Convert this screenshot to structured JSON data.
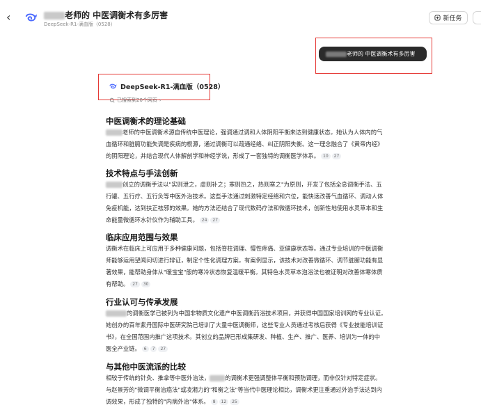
{
  "header": {
    "title_suffix": "老师的 中医调衡术有多厉害",
    "subtitle": "DeepSeek-R1-满血版（0528）",
    "new_task_label": "新任务"
  },
  "user_message": {
    "text_suffix": "老师的 中医调衡术有多厉害"
  },
  "answer": {
    "model_label": "DeepSeek-R1-满血版（0528）",
    "search_label": "已搜索到20个网页",
    "sections": [
      {
        "heading": "中医调衡术的理论基础",
        "lines": [
          "老师的中医调衡术源自传统中医理论，强调通过调和人体阴阳平衡来达到健康状态。她认为人体内的气",
          "血循环和脏腑功能失调是疾病的根源，通过调衡可以疏通经络、纠正阴阳失衡。这一理念融合了《黄帝内经》",
          "的阴阳理论，并结合现代人体解剖学和神经学说，形成了一套独特的调衡医学体系。"
        ],
        "citations": [
          "10",
          "27"
        ]
      },
      {
        "heading": "技术特点与手法创新",
        "lines": [
          "创立的调衡手法以\"实则泄之，虚则补之；寒则热之，热则寒之\"为原则，开发了包括全息调衡手法、五",
          "行罐、五行疗、五行灸等中医外治技术。这些手法通过刺激特定经络和穴位，能快速改善气血循环、调动人体",
          "免疫机能，达到扶正祛邪的效果。她的方法还结合了现代数码疗法和微循环技术，创新性地使用水灵草本和生",
          "命能量微循环水针仪作为辅助工具。"
        ],
        "citations": [
          "24",
          "27"
        ]
      },
      {
        "heading": "临床应用范围与效果",
        "lines": [
          "调衡术在临床上可应用于多种健康问题，包括脊柱调理、慢性疼痛、亚健康状态等。通过专业培训的中医调衡",
          "师能够运用望闻问切进行辩证，制定个性化调理方案。有案例显示，该技术对改善微循环、调节脏腑功能有显",
          "著效果，能帮助身体从\"暖宝宝\"般的寒冷状态恢复温暖平衡。其特色水灵草本泡浴法也被证明对改善体寒体质",
          "有帮助。"
        ],
        "citations": [
          "27",
          "30"
        ]
      },
      {
        "heading": "行业认可与传承发展",
        "lines": [
          "的调衡医学已被列为中国非物质文化遗产中医调衡药浴技术项目，并获得中国国家培训网的专业认证。",
          "她创办的百年紫丹国际中医研究院已培训了大量中医调衡师，这些专业人员通过考核后获得《专业技能培训证",
          "书》，在全国范围内推广这项技术。其创立的品牌已形成集研发、种植、生产、推广、医养、培训为一体的中",
          "医全产业链。"
        ],
        "citations": [
          "6",
          "7",
          "27"
        ]
      },
      {
        "heading": "与其他中医流派的比较",
        "lines": [
          "相较于传统的针灸、推拿等中医外治法，",
          "的调衡术更强调整体平衡和预防调理，而非仅针对特定症状。",
          "与赵景芳的\"微调平衡治癌法\"或凌湘力的\"和衡之法\"等当代中医理论相比，调衡术更注重通过外治手法达到内",
          "调效果，形成了独特的\"内病外治\"体系。"
        ],
        "citations": [
          "8",
          "12",
          "25"
        ]
      }
    ]
  },
  "colors": {
    "highlight_box": "#e53935",
    "bubble_bg": "#2b2b2b",
    "citation_bg": "#eef0f3"
  },
  "icons": [
    "back-arrow-icon",
    "deepseek-whale-icon",
    "new-task-icon",
    "more-icon",
    "chevron-right-icon"
  ]
}
